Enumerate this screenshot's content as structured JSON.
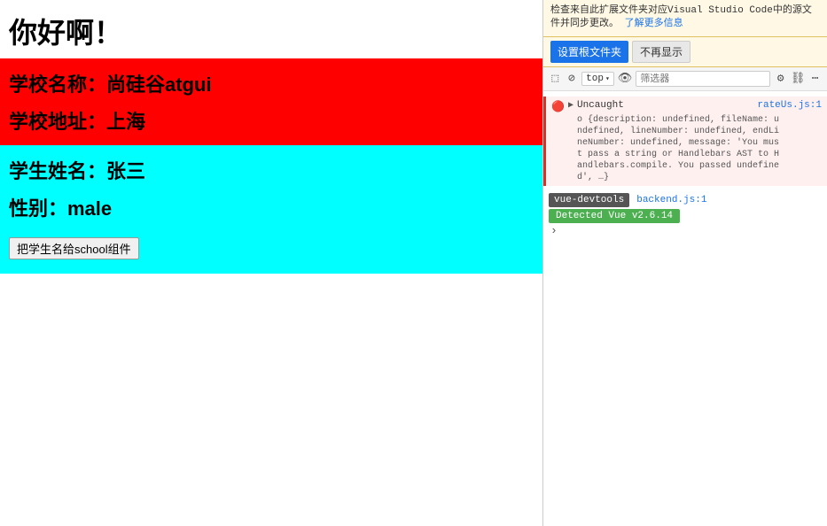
{
  "left": {
    "greeting": "你好啊！",
    "school": {
      "name_label": "学校名称：尚硅谷atgui",
      "address_label": "学校地址：上海"
    },
    "student": {
      "name_label": "学生姓名：张三",
      "gender_label": "性别：male",
      "button_label": "把学生名给school组件"
    }
  },
  "devtools": {
    "notice_text": "检查来自此扩展文件夹对应Visual Studio Code中的源文件并同步更改。",
    "notice_link": "了解更多信息",
    "btn_set_root": "设置根文件夹",
    "btn_no_show": "不再显示",
    "top_label": "top",
    "filter_placeholder": "筛选器",
    "error": {
      "type": "Uncaught",
      "file_link": "rateUs.js:1",
      "message": "o {description: undefined, fileName: undefined, lineNumber: undefined, endLineNumber: undefined, message: 'You must pass a string or Handlebars AST to Handlebars.compile. You passed undefined', …}",
      "collapsed_text": "▶ o {description: undefined, fileName: u ndefined, lineNumber: undefined, endLi neNumber: undefined, message: 'You mus t pass a string or Handlebars AST to H andlebars.compile. You passed undefine d', …}"
    },
    "vue_devtools": {
      "badge": "vue-devtools",
      "backend_link": "backend.js:1",
      "version_badge": "Detected Vue v2.6.14"
    }
  }
}
